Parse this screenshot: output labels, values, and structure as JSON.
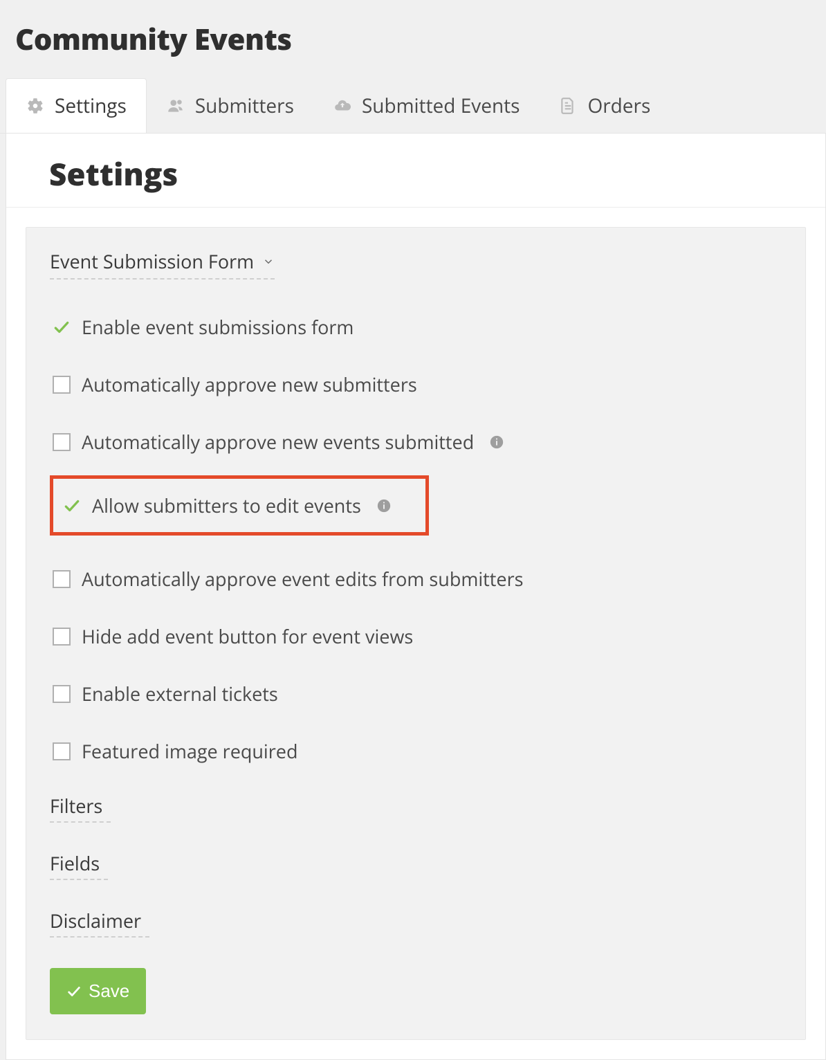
{
  "page": {
    "title": "Community Events"
  },
  "tabs": [
    {
      "label": "Settings",
      "icon": "gear-icon",
      "active": true
    },
    {
      "label": "Submitters",
      "icon": "users-icon",
      "active": false
    },
    {
      "label": "Submitted Events",
      "icon": "cloud-icon",
      "active": false
    },
    {
      "label": "Orders",
      "icon": "file-icon",
      "active": false
    }
  ],
  "section": {
    "title": "Settings"
  },
  "accordion": {
    "expanded_title": "Event Submission Form",
    "collapsed": [
      "Filters",
      "Fields",
      "Disclaimer"
    ]
  },
  "options": [
    {
      "label": "Enable event submissions form",
      "checked": true,
      "info": false,
      "highlighted": false
    },
    {
      "label": "Automatically approve new submitters",
      "checked": false,
      "info": false,
      "highlighted": false
    },
    {
      "label": "Automatically approve new events submitted",
      "checked": false,
      "info": true,
      "highlighted": false
    },
    {
      "label": "Allow submitters to edit events",
      "checked": true,
      "info": true,
      "highlighted": true
    },
    {
      "label": "Automatically approve event edits from submitters",
      "checked": false,
      "info": false,
      "highlighted": false
    },
    {
      "label": "Hide add event button for event views",
      "checked": false,
      "info": false,
      "highlighted": false
    },
    {
      "label": "Enable external tickets",
      "checked": false,
      "info": false,
      "highlighted": false
    },
    {
      "label": "Featured image required",
      "checked": false,
      "info": false,
      "highlighted": false
    }
  ],
  "footer": {
    "save_label": "Save"
  },
  "colors": {
    "accent_green": "#82c14f",
    "highlight_red": "#e44a2a",
    "icon_gray": "#b9b9b9"
  }
}
